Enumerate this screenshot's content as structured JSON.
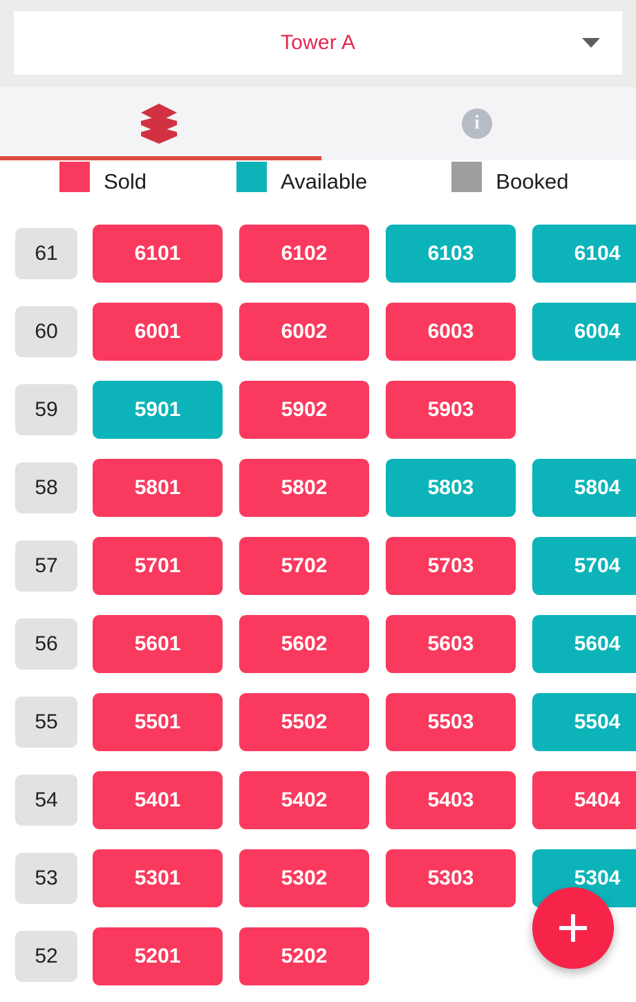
{
  "header": {
    "tower_label": "Tower A",
    "caret_icon": "chevron-down-icon",
    "accent_color": "#e0294f"
  },
  "tabs": {
    "active_index": 0,
    "indicator_color": "#dd4b3e",
    "items": [
      {
        "icon": "layers-icon",
        "label": "",
        "active": true
      },
      {
        "icon": "info-icon",
        "label": "",
        "active": false
      }
    ],
    "info_glyph": "i"
  },
  "legend": {
    "items": [
      {
        "label": "Sold",
        "color": "#f93a5e"
      },
      {
        "label": "Available",
        "color": "#0cb4b9"
      },
      {
        "label": "Booked",
        "color": "#9e9e9e"
      }
    ]
  },
  "fab": {
    "icon": "plus-icon",
    "label": "+",
    "color": "#f72449"
  },
  "grid": {
    "rows": [
      {
        "floor": "61",
        "units": [
          {
            "code": "6101",
            "status": "sold"
          },
          {
            "code": "6102",
            "status": "sold"
          },
          {
            "code": "6103",
            "status": "available"
          },
          {
            "code": "6104",
            "status": "available"
          }
        ]
      },
      {
        "floor": "60",
        "units": [
          {
            "code": "6001",
            "status": "sold"
          },
          {
            "code": "6002",
            "status": "sold"
          },
          {
            "code": "6003",
            "status": "sold"
          },
          {
            "code": "6004",
            "status": "available"
          }
        ]
      },
      {
        "floor": "59",
        "units": [
          {
            "code": "5901",
            "status": "available"
          },
          {
            "code": "5902",
            "status": "sold"
          },
          {
            "code": "5903",
            "status": "sold"
          },
          {
            "code": "",
            "status": "empty"
          }
        ]
      },
      {
        "floor": "58",
        "units": [
          {
            "code": "5801",
            "status": "sold"
          },
          {
            "code": "5802",
            "status": "sold"
          },
          {
            "code": "5803",
            "status": "available"
          },
          {
            "code": "5804",
            "status": "available"
          }
        ]
      },
      {
        "floor": "57",
        "units": [
          {
            "code": "5701",
            "status": "sold"
          },
          {
            "code": "5702",
            "status": "sold"
          },
          {
            "code": "5703",
            "status": "sold"
          },
          {
            "code": "5704",
            "status": "available"
          }
        ]
      },
      {
        "floor": "56",
        "units": [
          {
            "code": "5601",
            "status": "sold"
          },
          {
            "code": "5602",
            "status": "sold"
          },
          {
            "code": "5603",
            "status": "sold"
          },
          {
            "code": "5604",
            "status": "available"
          }
        ]
      },
      {
        "floor": "55",
        "units": [
          {
            "code": "5501",
            "status": "sold"
          },
          {
            "code": "5502",
            "status": "sold"
          },
          {
            "code": "5503",
            "status": "sold"
          },
          {
            "code": "5504",
            "status": "available"
          }
        ]
      },
      {
        "floor": "54",
        "units": [
          {
            "code": "5401",
            "status": "sold"
          },
          {
            "code": "5402",
            "status": "sold"
          },
          {
            "code": "5403",
            "status": "sold"
          },
          {
            "code": "5404",
            "status": "sold"
          }
        ]
      },
      {
        "floor": "53",
        "units": [
          {
            "code": "5301",
            "status": "sold"
          },
          {
            "code": "5302",
            "status": "sold"
          },
          {
            "code": "5303",
            "status": "sold"
          },
          {
            "code": "5304",
            "status": "available"
          }
        ]
      },
      {
        "floor": "52",
        "units": [
          {
            "code": "5201",
            "status": "sold"
          },
          {
            "code": "5202",
            "status": "sold"
          }
        ]
      }
    ]
  }
}
